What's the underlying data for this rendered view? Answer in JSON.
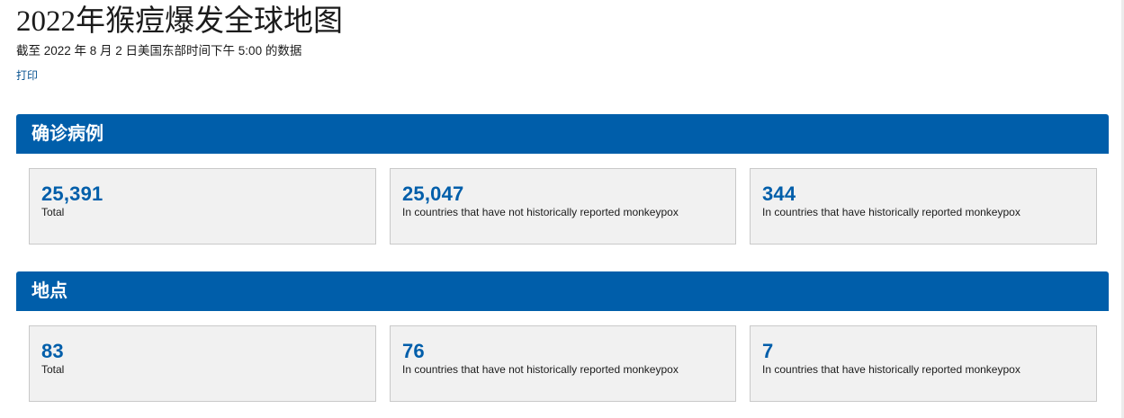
{
  "header": {
    "title": "2022年猴痘爆发全球地图",
    "subtitle": "截至 2022 年 8 月 2 日美国东部时间下午 5:00 的数据",
    "print_label": "打印"
  },
  "sections": [
    {
      "title": "确诊病例",
      "cards": [
        {
          "value": "25,391",
          "label": "Total"
        },
        {
          "value": "25,047",
          "label": "In countries that have not historically reported monkeypox"
        },
        {
          "value": "344",
          "label": "In countries that have historically reported monkeypox"
        }
      ]
    },
    {
      "title": "地点",
      "cards": [
        {
          "value": "83",
          "label": "Total"
        },
        {
          "value": "76",
          "label": "In countries that have not historically reported monkeypox"
        },
        {
          "value": "7",
          "label": "In countries that have historically reported monkeypox"
        }
      ]
    }
  ],
  "colors": {
    "accent": "#005eaa",
    "card_background": "#f1f1f1",
    "link": "#075290"
  }
}
